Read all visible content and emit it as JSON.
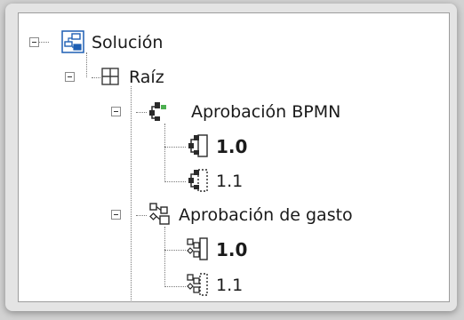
{
  "tree": {
    "root": {
      "label": "Solución",
      "icon": "solution-icon",
      "expanded": true
    },
    "folder": {
      "label": "Raíz",
      "icon": "folder-grid-icon",
      "expanded": true
    },
    "process1": {
      "label": "Aprobación BPMN",
      "icon": "bpmn-process-icon",
      "expanded": true,
      "versions": [
        {
          "label": "1.0",
          "bold": true
        },
        {
          "label": "1.1",
          "bold": false
        }
      ]
    },
    "process2": {
      "label": "Aprobación de gasto",
      "icon": "workflow-process-icon",
      "expanded": true,
      "versions": [
        {
          "label": "1.0",
          "bold": true
        },
        {
          "label": "1.1",
          "bold": false
        }
      ]
    }
  },
  "colors": {
    "panel_bg": "#ffffff",
    "frame_bg": "#e4e4e4",
    "icon_blue": "#1e5fb4",
    "line": "#7a7a7a"
  }
}
